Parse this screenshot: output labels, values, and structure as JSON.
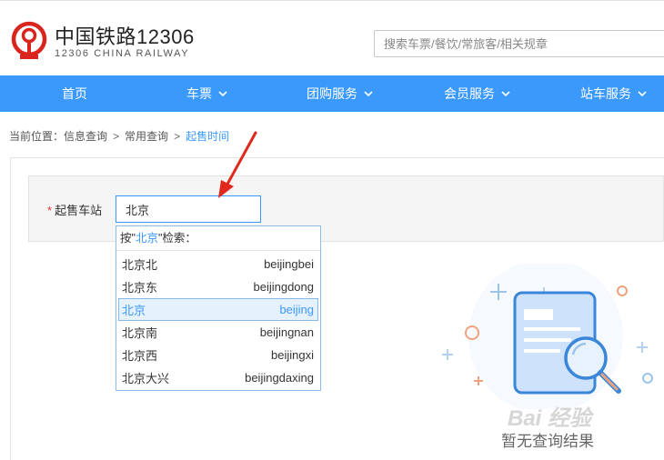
{
  "header": {
    "title": "中国铁路12306",
    "subtitle": "12306 CHINA RAILWAY",
    "search_placeholder": "搜索车票/餐饮/常旅客/相关规章"
  },
  "nav": {
    "items": [
      {
        "label": "首页",
        "has_dropdown": false
      },
      {
        "label": "车票",
        "has_dropdown": true
      },
      {
        "label": "团购服务",
        "has_dropdown": true
      },
      {
        "label": "会员服务",
        "has_dropdown": true
      },
      {
        "label": "站车服务",
        "has_dropdown": true
      }
    ]
  },
  "breadcrumb": {
    "prefix": "当前位置：",
    "items": [
      "信息查询",
      "常用查询",
      "起售时间"
    ],
    "separator": ">"
  },
  "form": {
    "required_mark": "*",
    "label": "起售车站",
    "value": "北京"
  },
  "dropdown": {
    "head_prefix": "按\"",
    "head_keyword": "北京",
    "head_suffix": "\"检索：",
    "items": [
      {
        "name": "北京北",
        "pinyin": "beijingbei"
      },
      {
        "name": "北京东",
        "pinyin": "beijingdong"
      },
      {
        "name": "北京",
        "pinyin": "beijing",
        "selected": true
      },
      {
        "name": "北京南",
        "pinyin": "beijingnan"
      },
      {
        "name": "北京西",
        "pinyin": "beijingxi"
      },
      {
        "name": "北京大兴",
        "pinyin": "beijingdaxing"
      }
    ]
  },
  "empty_state": {
    "text": "暂无查询结果"
  },
  "watermark": {
    "text": "Bai 经验"
  },
  "colors": {
    "brand_blue": "#3b99fc",
    "logo_red": "#d9251d",
    "arrow_red": "#e0281c"
  }
}
